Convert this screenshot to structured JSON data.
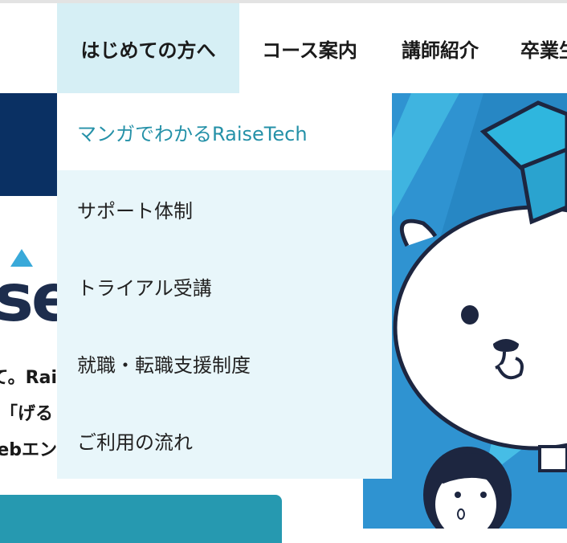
{
  "nav": {
    "items": [
      {
        "label": "はじめての方へ",
        "active": true
      },
      {
        "label": "コース案内",
        "active": false
      },
      {
        "label": "講師紹介",
        "active": false
      },
      {
        "label": "卒業生",
        "active": false
      }
    ]
  },
  "dropdown": {
    "items": [
      {
        "label": "マンガでわかるRaiseTech",
        "active": true
      },
      {
        "label": "サポート体制",
        "active": false
      },
      {
        "label": "トライアル受講",
        "active": false
      },
      {
        "label": "就職・転職支援制度",
        "active": false
      },
      {
        "label": "ご利用の流れ",
        "active": false
      }
    ]
  },
  "background": {
    "logo_fragment": "ise",
    "text_lines": [
      "て。Rai",
      "げる」",
      "ebエン"
    ]
  },
  "colors": {
    "nav_active_bg": "#d6eff5",
    "dropdown_bg": "#e8f6fa",
    "accent_teal": "#2591a8",
    "hero_navy": "#0a3063",
    "button_teal": "#2699b0",
    "illustration_blue": "#2f93d1"
  }
}
